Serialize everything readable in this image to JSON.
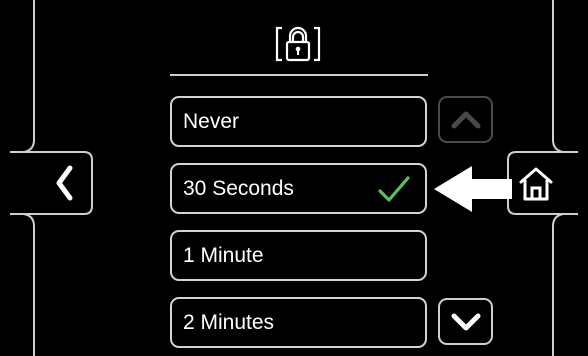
{
  "options": [
    {
      "label": "Never",
      "selected": false
    },
    {
      "label": "30 Seconds",
      "selected": true
    },
    {
      "label": "1 Minute",
      "selected": false
    },
    {
      "label": "2 Minutes",
      "selected": false
    }
  ],
  "icons": {
    "header": "padlock-icon",
    "back": "chevron-left-icon",
    "home": "home-icon",
    "scroll_up": "chevron-up-icon",
    "scroll_down": "chevron-down-icon",
    "selected": "checkmark-icon",
    "pointer": "arrow-left-icon"
  },
  "colors": {
    "background": "#000000",
    "border": "#d4d4d4",
    "check": "#5cc15a",
    "disabled": "#4a4a4a"
  }
}
